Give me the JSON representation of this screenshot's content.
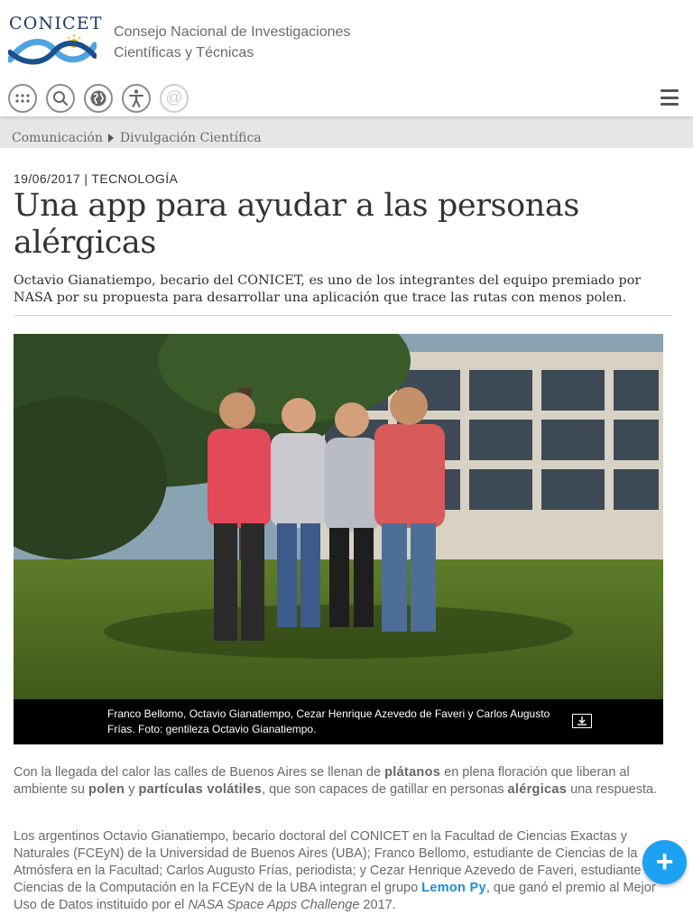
{
  "header": {
    "logo_text": "CONICET",
    "org_line1": "Consejo Nacional de Investigaciones",
    "org_line2": "Científicas y Técnicas",
    "icons": [
      "apps-grid-icon",
      "search-icon",
      "globe-icon",
      "accessibility-icon",
      "at-sign-icon"
    ],
    "at_glyph": "@"
  },
  "breadcrumb": {
    "item1": "Comunicación",
    "item2": "Divulgación Científica"
  },
  "article": {
    "meta": "19/06/2017 | TECNOLOGÍA",
    "title": "Una app para ayudar a las personas alérgicas",
    "subtitle": "Octavio Gianatiempo, becario del CONICET, es uno de los integrantes del equipo premiado por NASA por su propuesta para desarrollar una aplicación que trace las rutas con menos polen.",
    "caption": "Franco Bellomo, Octavio Gianatiempo, Cezar Henrique Azevedo de Faveri y Carlos Augusto Frías. Foto: gentileza Octavio Gianatiempo.",
    "p1": {
      "t1": "Con la llegada del calor las calles de Buenos Aires se llenan de ",
      "b1": "plátanos",
      "t2": " en plena floración que liberan al ambiente su ",
      "b2": "polen",
      "t3": " y ",
      "b3": "partículas volátiles",
      "t4": ", que son capaces de gatillar en personas ",
      "b4": "alérgicas",
      "t5": " una respuesta."
    },
    "p2": {
      "t1": "Los argentinos Octavio Gianatiempo, becario doctoral del CONICET en la Facultad de Ciencias Exactas y Naturales (FCEyN) de la Universidad de Buenos Aires (UBA); Franco Bellomo, estudiante de Ciencias de la Atmósfera en la Facultad; Carlos Augusto Frías, periodista; y Cezar Henrique Azevedo de Faveri, estudiante de Ciencias de la Computación en la FCEyN de la UBA integran el grupo ",
      "link": "Lemon Py",
      "t2": ", que ganó el premio al Mejor Uso de Datos instituido por el ",
      "i1": "NASA Space Apps Challenge",
      "t3": " 2017."
    }
  },
  "fab_label": "+",
  "colors": {
    "accent": "#1da1f2",
    "link": "#1f8dd6",
    "brand": "#1b3a63"
  }
}
